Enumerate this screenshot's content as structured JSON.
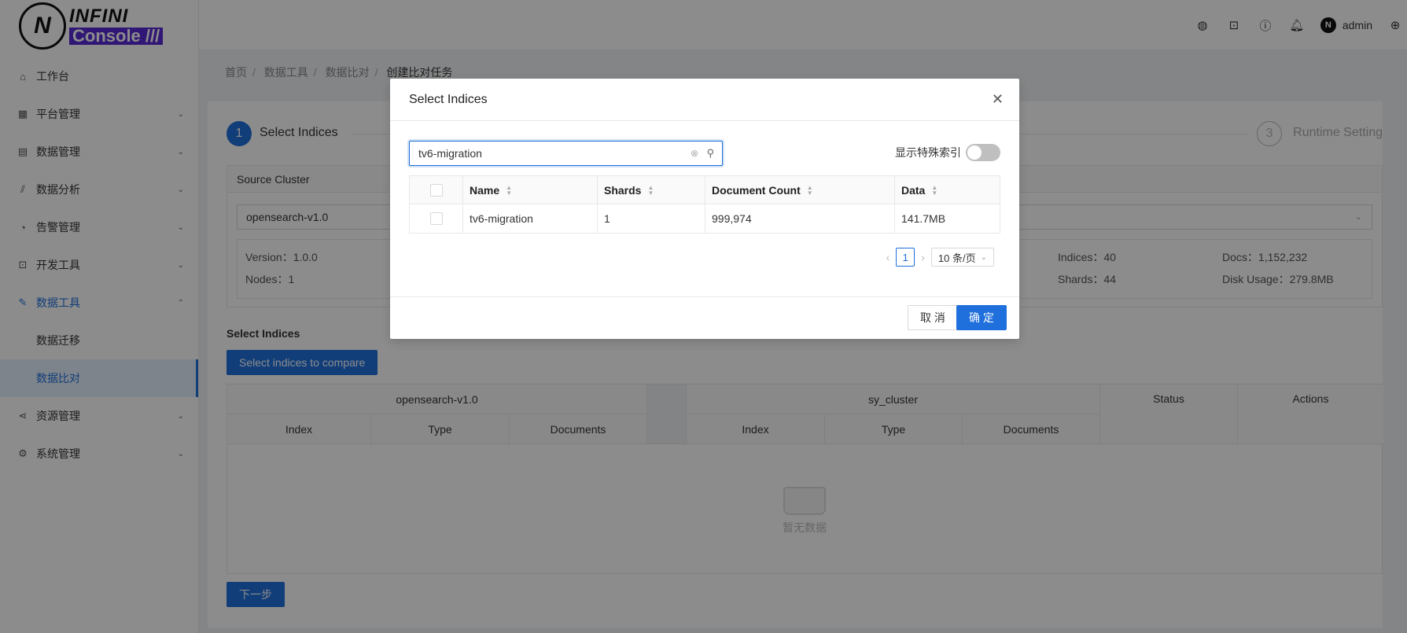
{
  "logo": {
    "mark": "N",
    "line1": "INFINI",
    "line2": "Console ///"
  },
  "menu": [
    {
      "label": "工作台",
      "icon": "home-icon",
      "glyph": "⌂",
      "arrow": ""
    },
    {
      "label": "平台管理",
      "icon": "dashboard-icon",
      "glyph": "▦",
      "arrow": "⌄"
    },
    {
      "label": "数据管理",
      "icon": "database-icon",
      "glyph": "▤",
      "arrow": "⌄"
    },
    {
      "label": "数据分析",
      "icon": "chart-icon",
      "glyph": "⫽",
      "arrow": "⌄"
    },
    {
      "label": "告警管理",
      "icon": "alert-icon",
      "glyph": "◔",
      "arrow": "⌄"
    },
    {
      "label": "开发工具",
      "icon": "code-icon",
      "glyph": "⊡",
      "arrow": "⌄"
    },
    {
      "label": "数据工具",
      "icon": "tool-icon",
      "glyph": "✎",
      "arrow": "⌃"
    },
    {
      "label": "数据迁移"
    },
    {
      "label": "数据比对"
    },
    {
      "label": "资源管理",
      "icon": "share-icon",
      "glyph": "⋖",
      "arrow": "⌄"
    },
    {
      "label": "系统管理",
      "icon": "settings-icon",
      "glyph": "⚙",
      "arrow": "⌄"
    }
  ],
  "topbar": {
    "user": "admin"
  },
  "breadcrumb": [
    "首页",
    "数据工具",
    "数据比对",
    "创建比对任务"
  ],
  "steps": {
    "step1_num": "1",
    "step1_label": "Select Indices",
    "step3_num": "3",
    "step3_label": "Runtime Setting"
  },
  "source": {
    "title": "Source Cluster",
    "cluster": "opensearch-v1.0",
    "version_label": "Version：",
    "version": "1.0.0",
    "nodes_label": "Nodes：",
    "nodes": "1",
    "indices_label": "Indices：",
    "indices": "40",
    "shards_label": "Shards：",
    "shards": "44",
    "docs_label": "Docs：",
    "docs": "1,152,232",
    "disk_label": "Disk Usage：",
    "disk": "279.8MB"
  },
  "compare": {
    "section_title": "Select Indices",
    "select_button": "Select indices to compare",
    "left_cluster": "opensearch-v1.0",
    "right_cluster": "sy_cluster",
    "col_index": "Index",
    "col_type": "Type",
    "col_documents": "Documents",
    "col_status": "Status",
    "col_actions": "Actions",
    "empty_text": "暂无数据",
    "next_button": "下一步"
  },
  "modal": {
    "title": "Select Indices",
    "search_value": "tv6-migration",
    "special_label": "显示特殊索引",
    "columns": {
      "name": "Name",
      "shards": "Shards",
      "doc_count": "Document Count",
      "data": "Data"
    },
    "rows": [
      {
        "name": "tv6-migration",
        "shards": "1",
        "doc_count": "999,974",
        "data": "141.7MB"
      }
    ],
    "page": "1",
    "page_size": "10 条/页",
    "cancel": "取 消",
    "ok": "确 定"
  }
}
